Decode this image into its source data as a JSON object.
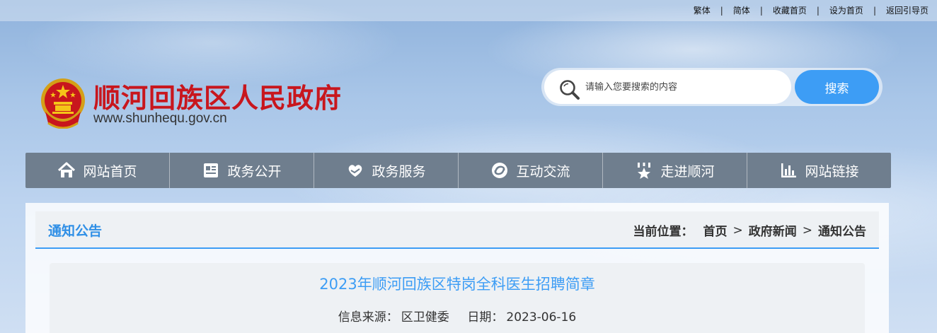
{
  "topbar": {
    "links": [
      "繁体",
      "简体",
      "收藏首页",
      "设为首页",
      "返回引导页"
    ],
    "separator": "|"
  },
  "header": {
    "title": "顺河回族区人民政府",
    "domain": "www.shunhequ.gov.cn",
    "emblem_icon": "national-emblem-icon"
  },
  "search": {
    "placeholder": "请输入您要搜索的内容",
    "button_label": "搜索",
    "accent": "#3d9df5"
  },
  "nav": {
    "items": [
      {
        "label": "网站首页",
        "icon": "home-icon"
      },
      {
        "label": "政务公开",
        "icon": "document-icon"
      },
      {
        "label": "政务服务",
        "icon": "heart-hand-icon"
      },
      {
        "label": "互动交流",
        "icon": "chat-swirl-icon"
      },
      {
        "label": "走进顺河",
        "icon": "star-badge-icon"
      },
      {
        "label": "网站链接",
        "icon": "bar-chart-icon"
      }
    ],
    "background": "#6f7e8e"
  },
  "section": {
    "title": "通知公告",
    "breadcrumb_label": "当前位置：",
    "breadcrumb": [
      "首页",
      "政府新闻",
      "通知公告"
    ],
    "arrow": ">"
  },
  "article": {
    "title": "2023年顺河回族区特岗全科医生招聘简章",
    "source_label": "信息来源：",
    "source": "区卫健委",
    "date_label": "日期：",
    "date": "2023-06-16"
  }
}
